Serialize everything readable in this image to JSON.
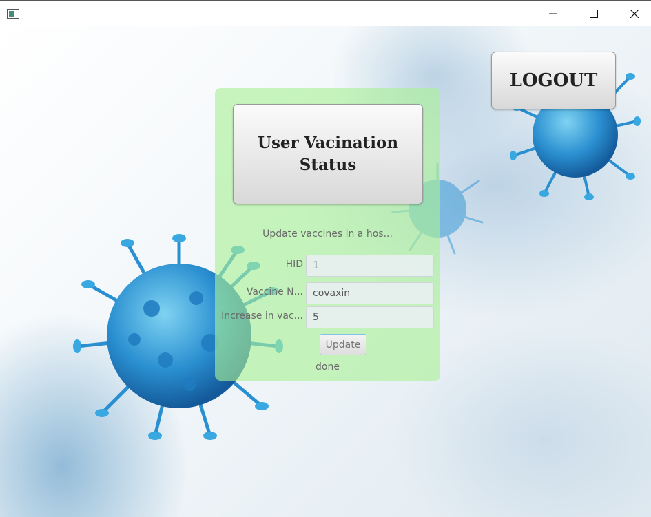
{
  "window": {
    "app_icon": "window-app-icon",
    "controls": {
      "minimize_icon": "minimize-icon",
      "maximize_icon": "maximize-icon",
      "close_icon": "close-icon"
    }
  },
  "header": {
    "status_title": "User Vacination Status",
    "logout_label": "LOGOUT"
  },
  "form": {
    "subtitle": "Update vaccines in a hos...",
    "hid_label": "HID",
    "hid_value": "1",
    "vaccine_label": "Vaccine N...",
    "vaccine_value": "covaxin",
    "increase_label": "Increase in vac...",
    "increase_value": "5",
    "update_label": "Update",
    "result_text": "done"
  },
  "colors": {
    "panel": "#aaf096",
    "update_border": "#7fc3e6",
    "virus": "#2a8fd0"
  }
}
